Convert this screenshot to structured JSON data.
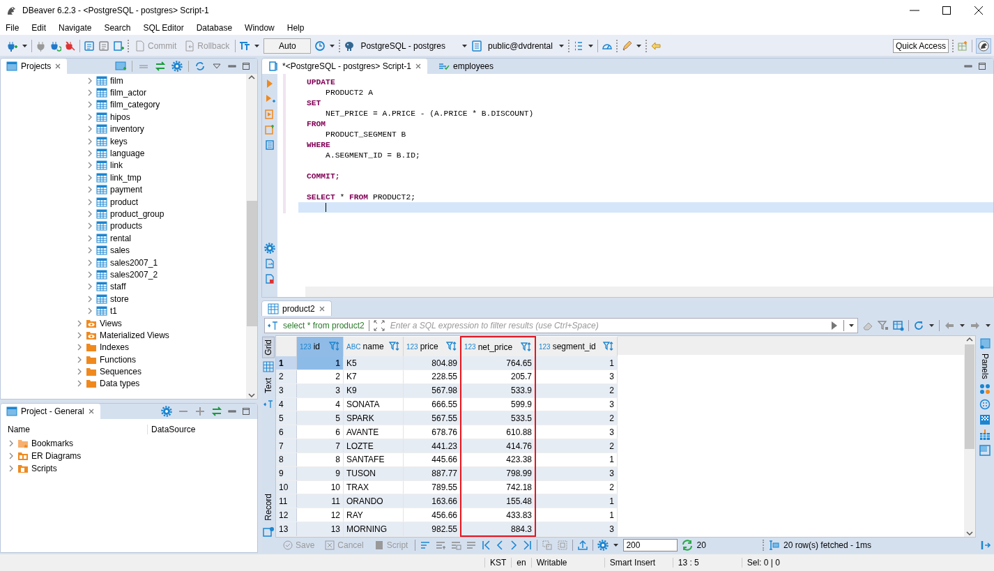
{
  "window": {
    "title": "DBeaver 6.2.3 - <PostgreSQL - postgres> Script-1"
  },
  "menu": [
    "File",
    "Edit",
    "Navigate",
    "Search",
    "SQL Editor",
    "Database",
    "Window",
    "Help"
  ],
  "toolbar": {
    "buttons": [
      {
        "label": "Commit",
        "disabled": true
      },
      {
        "label": "Rollback",
        "disabled": true
      }
    ],
    "transaction_mode": "Auto",
    "connection": "PostgreSQL - postgres",
    "schema": "public@dvdrental",
    "quick_access": "Quick Access"
  },
  "projects": {
    "tab": "Projects",
    "tree": [
      {
        "children": [
          {
            "label": "film",
            "kind": "table",
            "expanded": false
          },
          {
            "label": "film_actor",
            "kind": "table",
            "expanded": false
          },
          {
            "label": "film_category",
            "kind": "table",
            "expanded": false
          },
          {
            "label": "hipos",
            "kind": "table",
            "expanded": false
          },
          {
            "label": "inventory",
            "kind": "table",
            "expanded": false
          },
          {
            "label": "keys",
            "kind": "table",
            "expanded": false
          },
          {
            "label": "language",
            "kind": "table",
            "expanded": false
          },
          {
            "label": "link",
            "kind": "table",
            "expanded": false
          },
          {
            "label": "link_tmp",
            "kind": "table",
            "expanded": false
          },
          {
            "label": "payment",
            "kind": "table",
            "expanded": false
          },
          {
            "label": "product",
            "kind": "table",
            "expanded": false
          },
          {
            "label": "product_group",
            "kind": "table",
            "expanded": false
          },
          {
            "label": "products",
            "kind": "table",
            "expanded": false
          },
          {
            "label": "rental",
            "kind": "table",
            "expanded": false
          },
          {
            "label": "sales",
            "kind": "table",
            "expanded": false
          },
          {
            "label": "sales2007_1",
            "kind": "table",
            "expanded": false
          },
          {
            "label": "sales2007_2",
            "kind": "table",
            "expanded": false
          },
          {
            "label": "staff",
            "kind": "table",
            "expanded": false
          },
          {
            "label": "store",
            "kind": "table",
            "expanded": false
          },
          {
            "label": "t1",
            "kind": "table",
            "expanded": false
          }
        ]
      },
      {
        "label": "Views",
        "kind": "view",
        "expanded": false
      },
      {
        "label": "Materialized Views",
        "kind": "view",
        "expanded": false
      },
      {
        "label": "Indexes",
        "kind": "folder",
        "expanded": false
      },
      {
        "label": "Functions",
        "kind": "folder",
        "expanded": false
      },
      {
        "label": "Sequences",
        "kind": "folder",
        "expanded": false
      },
      {
        "label": "Data types",
        "kind": "folder",
        "expanded": false
      }
    ]
  },
  "project_general": {
    "tab": "Project - General",
    "columns": [
      "Name",
      "DataSource"
    ],
    "items": [
      {
        "label": "Bookmarks",
        "kind": "bookmarks",
        "expanded": false
      },
      {
        "label": "ER Diagrams",
        "kind": "diagrams",
        "expanded": false
      },
      {
        "label": "Scripts",
        "kind": "scripts",
        "expanded": false
      }
    ]
  },
  "editor": {
    "tabs": [
      {
        "label": "*<PostgreSQL - postgres> Script-1",
        "kind": "script",
        "selected": true
      },
      {
        "label": "employees",
        "kind": "table",
        "selected": false
      }
    ],
    "lines": [
      {
        "text": "UPDATE",
        "kind": "keyword",
        "current": false
      },
      {
        "text": "    PRODUCT2 A",
        "kind": "plain",
        "current": false
      },
      {
        "text": "SET",
        "kind": "keyword",
        "current": false
      },
      {
        "text": "    NET_PRICE = A.PRICE - (A.PRICE * B.DISCOUNT)",
        "kind": "plain",
        "current": false
      },
      {
        "text": "FROM",
        "kind": "keyword",
        "current": false
      },
      {
        "text": "    PRODUCT_SEGMENT B",
        "kind": "plain",
        "current": false
      },
      {
        "text": "WHERE",
        "kind": "keyword",
        "current": false
      },
      {
        "text": "    A.SEGMENT_ID = B.ID;",
        "kind": "plain",
        "current": false
      },
      {
        "current": false
      },
      {
        "text": "COMMIT;",
        "kind": "keyword",
        "current": false
      },
      {
        "current": false
      },
      {
        "text": "**SELECT** * **FROM** PRODUCT2;",
        "kind": "plain",
        "current": false
      },
      {
        "current": true
      }
    ]
  },
  "results": {
    "tab": "product2",
    "query": "select * from product2",
    "filter": {
      "placeholder": "Enter a SQL expression to filter results (use Ctrl+Space)"
    },
    "side_tabs": [
      {
        "label": "Grid",
        "selected": true
      },
      {
        "label": "Text",
        "selected": false
      },
      {
        "label": "Record",
        "selected": false
      }
    ],
    "columns": [
      {
        "type": "123",
        "name": "id",
        "highlighted": false
      },
      {
        "type": "ABC",
        "name": "name",
        "highlighted": false
      },
      {
        "type": "123",
        "name": "price",
        "highlighted": false
      },
      {
        "type": "123",
        "name": "net_price",
        "highlighted": true
      },
      {
        "type": "123",
        "name": "segment_id",
        "highlighted": false
      }
    ],
    "rows": [
      {
        "number": "1",
        "selected": true,
        "cells": [
          "1",
          "K5",
          "804.89",
          "764.65",
          "1"
        ]
      },
      {
        "number": "2",
        "selected": false,
        "cells": [
          "2",
          "K7",
          "228.55",
          "205.7",
          "3"
        ]
      },
      {
        "number": "3",
        "selected": false,
        "cells": [
          "3",
          "K9",
          "567.98",
          "533.9",
          "2"
        ]
      },
      {
        "number": "4",
        "selected": false,
        "cells": [
          "4",
          "SONATA",
          "666.55",
          "599.9",
          "3"
        ]
      },
      {
        "number": "5",
        "selected": false,
        "cells": [
          "5",
          "SPARK",
          "567.55",
          "533.5",
          "2"
        ]
      },
      {
        "number": "6",
        "selected": false,
        "cells": [
          "6",
          "AVANTE",
          "678.76",
          "610.88",
          "3"
        ]
      },
      {
        "number": "7",
        "selected": false,
        "cells": [
          "7",
          "LOZTE",
          "441.23",
          "414.76",
          "2"
        ]
      },
      {
        "number": "8",
        "selected": false,
        "cells": [
          "8",
          "SANTAFE",
          "445.66",
          "423.38",
          "1"
        ]
      },
      {
        "number": "9",
        "selected": false,
        "cells": [
          "9",
          "TUSON",
          "887.77",
          "798.99",
          "3"
        ]
      },
      {
        "number": "10",
        "selected": false,
        "cells": [
          "10",
          "TRAX",
          "789.55",
          "742.18",
          "2"
        ]
      },
      {
        "number": "11",
        "selected": false,
        "cells": [
          "11",
          "ORANDO",
          "163.66",
          "155.48",
          "1"
        ]
      },
      {
        "number": "12",
        "selected": false,
        "cells": [
          "12",
          "RAY",
          "456.66",
          "433.83",
          "1"
        ]
      },
      {
        "number": "13",
        "selected": false,
        "cells": [
          "13",
          "MORNING",
          "982.55",
          "884.3",
          "3"
        ]
      }
    ],
    "footer": {
      "buttons": [
        {
          "label": "Save",
          "disabled": true
        },
        {
          "label": "Cancel",
          "disabled": true
        },
        {
          "label": "Script",
          "disabled": true
        }
      ],
      "page_size": "200",
      "fetch_count": "20",
      "status": "20 row(s) fetched - 1ms"
    },
    "panels_tab": "Panels"
  },
  "status_bar": [
    "KST",
    "en",
    "Writable",
    "Smart Insert",
    "13 : 5",
    "Sel: 0 | 0"
  ]
}
